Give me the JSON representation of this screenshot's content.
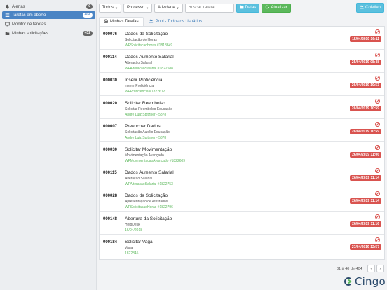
{
  "sidebar": {
    "items": [
      {
        "label": "Alertas",
        "badge": "0",
        "icon": "bell-icon",
        "active": false
      },
      {
        "label": "Tarefas em aberto",
        "badge": "404",
        "icon": "list-icon",
        "active": true
      },
      {
        "label": "Monitor de tarefas",
        "badge": "",
        "icon": "monitor-icon",
        "active": false
      },
      {
        "label": "Minhas solicitações",
        "badge": "432",
        "icon": "folder-icon",
        "active": false
      }
    ]
  },
  "toolbar": {
    "todos_label": "Todos",
    "processo_label": "Processo",
    "atividade_label": "Atividade",
    "search_placeholder": "Buscar Tarefa",
    "datas_label": "Datas",
    "atualizar_label": "Atualizar",
    "coletivo_label": "Coletivo"
  },
  "tabs": [
    {
      "label": "Minhas Tarefas",
      "icon": "inbox-icon",
      "active": true
    },
    {
      "label": "Pool - Todos os Usuários",
      "icon": "users-icon",
      "active": false
    }
  ],
  "tasks": [
    {
      "id": "000076",
      "title": "Dados da Solicitação",
      "subtitle": "Solicitação de Horas",
      "link": "WFSolicitacaohoras #1818849",
      "date": "15/04/2019 16:11"
    },
    {
      "id": "000114",
      "title": "Dados Aumento Salarial",
      "subtitle": "Alteração Salarial",
      "link": "WFAlteracaoSalarial #1822588",
      "date": "25/04/2019 08:48"
    },
    {
      "id": "000030",
      "title": "Inserir Proficiência",
      "subtitle": "Inserir Proficiência",
      "link": "WFProficiencia #1822612",
      "date": "26/04/2019 10:53"
    },
    {
      "id": "000020",
      "title": "Solicitar Reembolso",
      "subtitle": "Solicitar Reembolso Educação",
      "link": "Andre Luiz Spitzner - 5878",
      "date": "26/04/2019 10:59"
    },
    {
      "id": "000007",
      "title": "Preencher Dados",
      "subtitle": "Solicitação Auxílio Educação",
      "link": "Andre Luiz Spitzner - 5878",
      "date": "26/04/2019 10:59"
    },
    {
      "id": "000030",
      "title": "Solicitar Movimentação",
      "subtitle": "Movimentação Avançado",
      "link": "WFMovimentacaoAvancado #1822609",
      "date": "26/04/2019 11:06"
    },
    {
      "id": "000115",
      "title": "Dados Aumento Salarial",
      "subtitle": "Alteração Salarial",
      "link": "WFAlteracaoSalarial #1822753",
      "date": "26/04/2019 11:14"
    },
    {
      "id": "000028",
      "title": "Dados da Solicitação",
      "subtitle": "Apresentação de Atestados",
      "link": "WFSolicitacaoHoras #1822796",
      "date": "26/04/2019 11:14"
    },
    {
      "id": "000148",
      "title": "Abertura da Solicitação",
      "subtitle": "HelpDesk",
      "link": "16/04/2018",
      "date": "26/04/2019 11:16"
    },
    {
      "id": "000184",
      "title": "Solicitar Vaga",
      "subtitle": "Vaga",
      "link": "1822845",
      "date": "27/04/2019 12:57"
    }
  ],
  "pagination": {
    "text": "31 à 40 de 404",
    "prev_icon": "chevron-left-icon",
    "next_icon": "chevron-right-icon"
  },
  "logo": {
    "text": "Cingo"
  },
  "colors": {
    "accent": "#4a84c4",
    "danger": "#d9534f",
    "success": "#5cb85c",
    "info": "#5bc0de"
  }
}
